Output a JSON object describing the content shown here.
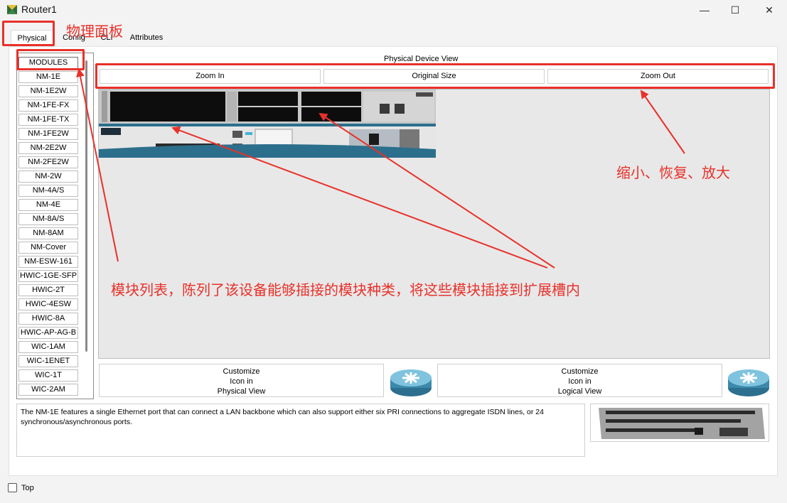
{
  "window": {
    "title": "Router1",
    "minimize_glyph": "—",
    "maximize_glyph": "☐",
    "close_glyph": "✕"
  },
  "tabs": [
    {
      "label": "Physical",
      "active": true
    },
    {
      "label": "Config",
      "active": false
    },
    {
      "label": "CLI",
      "active": false
    },
    {
      "label": "Attributes",
      "active": false
    }
  ],
  "modules": {
    "header": "MODULES",
    "items": [
      "NM-1E",
      "NM-1E2W",
      "NM-1FE-FX",
      "NM-1FE-TX",
      "NM-1FE2W",
      "NM-2E2W",
      "NM-2FE2W",
      "NM-2W",
      "NM-4A/S",
      "NM-4E",
      "NM-8A/S",
      "NM-8AM",
      "NM-Cover",
      "NM-ESW-161",
      "HWIC-1GE-SFP",
      "HWIC-2T",
      "HWIC-4ESW",
      "HWIC-8A",
      "HWIC-AP-AG-B",
      "WIC-1AM",
      "WIC-1ENET",
      "WIC-1T",
      "WIC-2AM"
    ]
  },
  "device_view": {
    "label": "Physical Device View",
    "zoom_in": "Zoom In",
    "original_size": "Original Size",
    "zoom_out": "Zoom Out"
  },
  "customize": {
    "physical": {
      "line1": "Customize",
      "line2": "Icon in",
      "line3": "Physical View"
    },
    "logical": {
      "line1": "Customize",
      "line2": "Icon in",
      "line3": "Logical View"
    }
  },
  "description": "The NM-1E features a single Ethernet port that can connect a LAN backbone which can also support either six PRI connections to aggregate ISDN lines, or 24 synchronous/asynchronous ports.",
  "footer": {
    "top_label": "Top",
    "top_checked": false
  },
  "annotations": {
    "physical_panel": "物理面板",
    "zoom_note": "缩小、恢复、放大",
    "modules_note": "模块列表，陈列了该设备能够插接的模块种类，将这些模块插接到扩展槽内"
  },
  "colors": {
    "accent": "#0a4c9c",
    "annotation_red": "#e8312a"
  }
}
